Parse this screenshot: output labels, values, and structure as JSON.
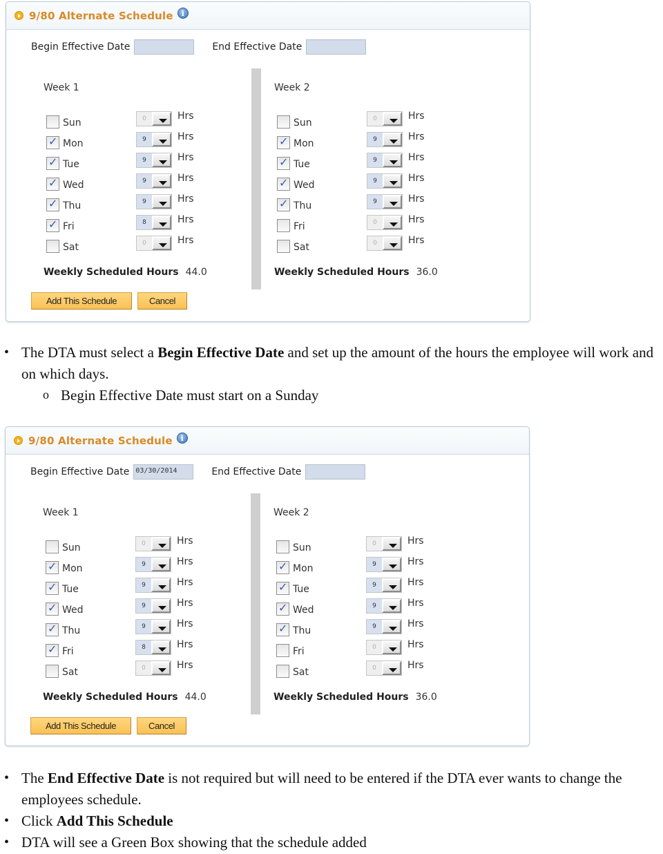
{
  "panels": [
    {
      "title": "9/80 Alternate Schedule",
      "begin_label": "Begin Effective Date",
      "begin_value": "",
      "end_label": "End Effective Date",
      "end_value": "",
      "weeks": [
        {
          "title": "Week 1",
          "days": [
            {
              "label": "Sun",
              "checked": false,
              "hours": "0"
            },
            {
              "label": "Mon",
              "checked": true,
              "hours": "9"
            },
            {
              "label": "Tue",
              "checked": true,
              "hours": "9"
            },
            {
              "label": "Wed",
              "checked": true,
              "hours": "9"
            },
            {
              "label": "Thu",
              "checked": true,
              "hours": "9"
            },
            {
              "label": "Fri",
              "checked": true,
              "hours": "8"
            },
            {
              "label": "Sat",
              "checked": false,
              "hours": "0"
            }
          ],
          "hrs_unit": "Hrs",
          "weekly_label": "Weekly Scheduled Hours",
          "weekly_value": "44.0"
        },
        {
          "title": "Week 2",
          "days": [
            {
              "label": "Sun",
              "checked": false,
              "hours": "0"
            },
            {
              "label": "Mon",
              "checked": true,
              "hours": "9"
            },
            {
              "label": "Tue",
              "checked": true,
              "hours": "9"
            },
            {
              "label": "Wed",
              "checked": true,
              "hours": "9"
            },
            {
              "label": "Thu",
              "checked": true,
              "hours": "9"
            },
            {
              "label": "Fri",
              "checked": false,
              "hours": "0"
            },
            {
              "label": "Sat",
              "checked": false,
              "hours": "0"
            }
          ],
          "hrs_unit": "Hrs",
          "weekly_label": "Weekly Scheduled Hours",
          "weekly_value": "36.0"
        }
      ],
      "add_button": "Add This Schedule",
      "cancel_button": "Cancel"
    },
    {
      "title": "9/80 Alternate Schedule",
      "begin_label": "Begin Effective Date",
      "begin_value": "03/30/2014",
      "end_label": "End Effective Date",
      "end_value": "",
      "weeks": [
        {
          "title": "Week 1",
          "days": [
            {
              "label": "Sun",
              "checked": false,
              "hours": "0"
            },
            {
              "label": "Mon",
              "checked": true,
              "hours": "9"
            },
            {
              "label": "Tue",
              "checked": true,
              "hours": "9"
            },
            {
              "label": "Wed",
              "checked": true,
              "hours": "9"
            },
            {
              "label": "Thu",
              "checked": true,
              "hours": "9"
            },
            {
              "label": "Fri",
              "checked": true,
              "hours": "8"
            },
            {
              "label": "Sat",
              "checked": false,
              "hours": "0"
            }
          ],
          "hrs_unit": "Hrs",
          "weekly_label": "Weekly Scheduled Hours",
          "weekly_value": "44.0"
        },
        {
          "title": "Week 2",
          "days": [
            {
              "label": "Sun",
              "checked": false,
              "hours": "0"
            },
            {
              "label": "Mon",
              "checked": true,
              "hours": "9"
            },
            {
              "label": "Tue",
              "checked": true,
              "hours": "9"
            },
            {
              "label": "Wed",
              "checked": true,
              "hours": "9"
            },
            {
              "label": "Thu",
              "checked": true,
              "hours": "9"
            },
            {
              "label": "Fri",
              "checked": false,
              "hours": "0"
            },
            {
              "label": "Sat",
              "checked": false,
              "hours": "0"
            }
          ],
          "hrs_unit": "Hrs",
          "weekly_label": "Weekly Scheduled Hours",
          "weekly_value": "36.0"
        }
      ],
      "add_button": "Add This Schedule",
      "cancel_button": "Cancel"
    }
  ],
  "instructions_1": {
    "bullet_1": {
      "pre": "The DTA must select a ",
      "bold": "Begin Effective Date",
      "post": " and set up the amount of the hours the employee will work and on which days."
    },
    "sub_bullet_1": "Begin Effective Date must start on a Sunday"
  },
  "instructions_2": {
    "bullet_1": {
      "pre": "The ",
      "bold": "End Effective Date",
      "post": " is not required but will need to be entered if the DTA ever wants to change the employees schedule."
    },
    "bullet_2": {
      "pre": "Click ",
      "bold": "Add This Schedule"
    },
    "bullet_3": "DTA will see a Green Box showing that the schedule added"
  },
  "icons": {
    "collapse": "collapse-circle-icon",
    "info": "info-icon",
    "info_glyph": "i",
    "dropdown": "chevron-down-icon"
  }
}
